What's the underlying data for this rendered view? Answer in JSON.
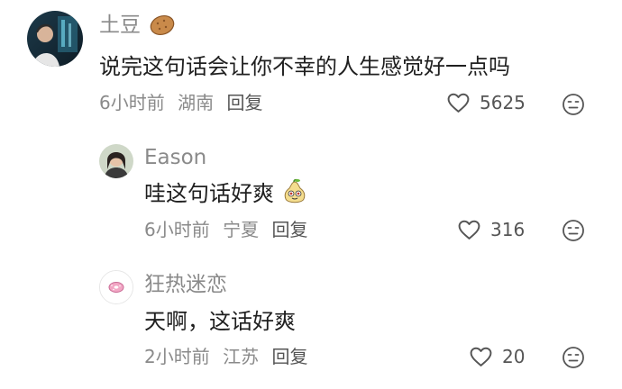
{
  "comments": [
    {
      "username": "土豆",
      "username_emoji": "potato-emoji",
      "text": "说完这句话会让你不幸的人生感觉好一点吗",
      "time": "6小时前",
      "location": "湖南",
      "reply_label": "回复",
      "likes": "5625"
    },
    {
      "username": "Eason",
      "text": "哇这句话好爽",
      "text_emoji": "pear-face-emoji",
      "time": "6小时前",
      "location": "宁夏",
      "reply_label": "回复",
      "likes": "316"
    },
    {
      "username": "狂热迷恋",
      "text": "天啊，这话好爽",
      "time": "2小时前",
      "location": "江苏",
      "reply_label": "回复",
      "likes": "20"
    }
  ],
  "icons": {
    "like": "heart-outline-icon",
    "more": "dislike-face-icon"
  },
  "colors": {
    "text_primary": "#1f1f1f",
    "text_secondary": "#8a8a8a",
    "icon_gray": "#555555"
  }
}
